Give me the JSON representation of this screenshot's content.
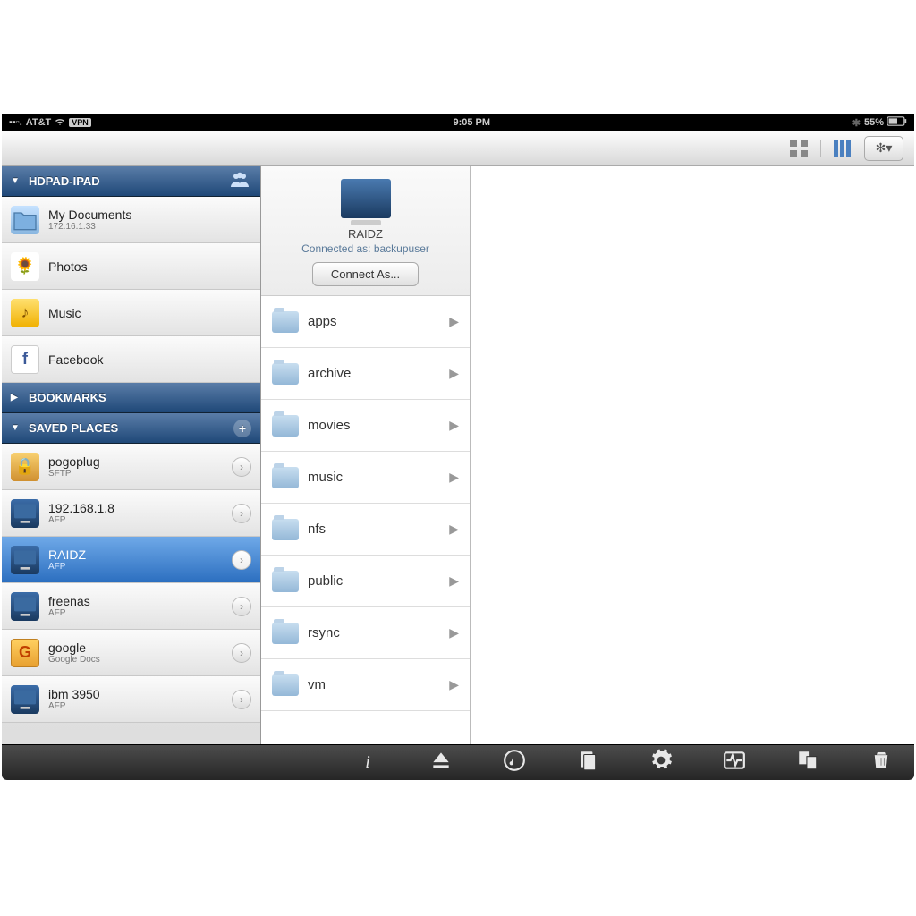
{
  "status": {
    "carrier": "AT&T",
    "vpn": "VPN",
    "time": "9:05 PM",
    "battery": "55%"
  },
  "sidebar": {
    "sections": {
      "device": {
        "title": "HDPAD-IPAD"
      },
      "bookmarks": {
        "title": "BOOKMARKS"
      },
      "saved_places": {
        "title": "SAVED PLACES"
      }
    },
    "device_items": [
      {
        "label": "My Documents",
        "sub": "172.16.1.33",
        "icon": "folder"
      },
      {
        "label": "Photos",
        "icon": "photos"
      },
      {
        "label": "Music",
        "icon": "music"
      },
      {
        "label": "Facebook",
        "icon": "fb"
      }
    ],
    "saved_items": [
      {
        "label": "pogoplug",
        "sub": "SFTP",
        "icon": "sftp"
      },
      {
        "label": "192.168.1.8",
        "sub": "AFP",
        "icon": "comp"
      },
      {
        "label": "RAIDZ",
        "sub": "AFP",
        "icon": "comp",
        "selected": true
      },
      {
        "label": "freenas",
        "sub": "AFP",
        "icon": "comp"
      },
      {
        "label": "google",
        "sub": "Google Docs",
        "icon": "g"
      },
      {
        "label": "ibm 3950",
        "sub": "AFP",
        "icon": "comp"
      }
    ]
  },
  "server": {
    "name": "RAIDZ",
    "connected_as_label": "Connected as: backupuser",
    "connect_btn": "Connect As..."
  },
  "folders": [
    {
      "name": "apps"
    },
    {
      "name": "archive"
    },
    {
      "name": "movies"
    },
    {
      "name": "music"
    },
    {
      "name": "nfs"
    },
    {
      "name": "public"
    },
    {
      "name": "rsync"
    },
    {
      "name": "vm"
    }
  ]
}
